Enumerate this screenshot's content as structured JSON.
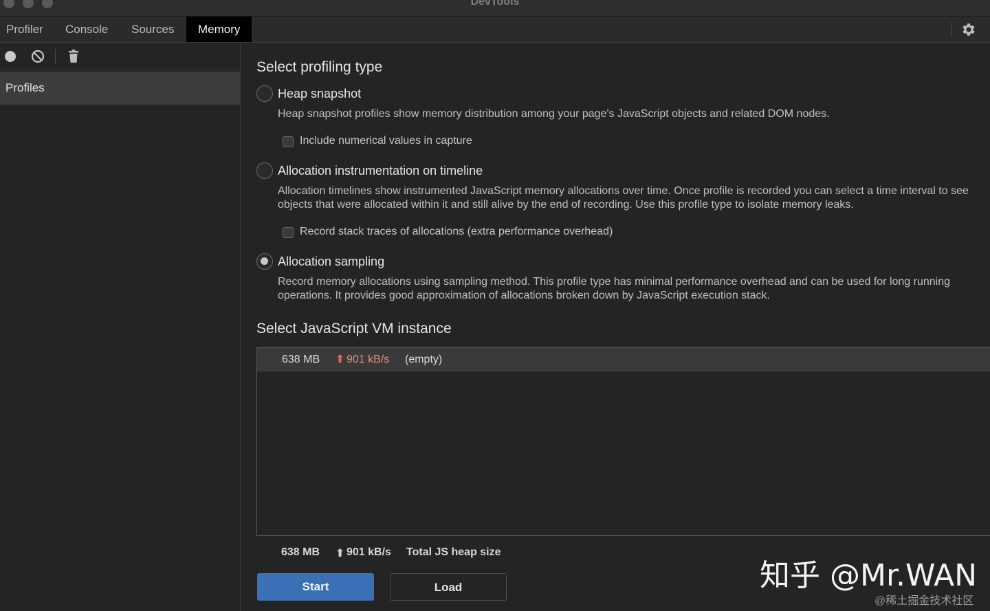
{
  "window": {
    "title": "DevTools"
  },
  "tabs": [
    {
      "label": "Profiler"
    },
    {
      "label": "Console"
    },
    {
      "label": "Sources"
    },
    {
      "label": "Memory",
      "active": true
    }
  ],
  "sidebar": {
    "toolbar": {
      "record_icon": "record-icon",
      "clear_icon": "clear-icon",
      "delete_icon": "trash-icon"
    },
    "items": [
      {
        "label": "Profiles"
      }
    ]
  },
  "profiling": {
    "title": "Select profiling type",
    "options": [
      {
        "label": "Heap snapshot",
        "description": "Heap snapshot profiles show memory distribution among your page's JavaScript objects and related DOM nodes.",
        "checkbox_label": "Include numerical values in capture",
        "selected": false
      },
      {
        "label": "Allocation instrumentation on timeline",
        "description": "Allocation timelines show instrumented JavaScript memory allocations over time. Once profile is recorded you can select a time interval to see objects that were allocated within it and still alive by the end of recording. Use this profile type to isolate memory leaks.",
        "checkbox_label": "Record stack traces of allocations (extra performance overhead)",
        "selected": false
      },
      {
        "label": "Allocation sampling",
        "description": "Record memory allocations using sampling method. This profile type has minimal performance overhead and can be used for long running operations. It provides good approximation of allocations broken down by JavaScript execution stack.",
        "selected": true
      }
    ]
  },
  "vm": {
    "title": "Select JavaScript VM instance",
    "instances": [
      {
        "size": "638 MB",
        "rate": "901 kB/s",
        "name": "(empty)"
      }
    ]
  },
  "footer": {
    "size": "638 MB",
    "rate": "901 kB/s",
    "label": "Total JS heap size",
    "start_label": "Start",
    "load_label": "Load"
  },
  "watermark": {
    "main": "知乎 @Mr.WAN",
    "sub": "@稀土掘金技术社区"
  },
  "colors": {
    "accent": "#3b6fb6",
    "rate": "#e98d7d",
    "background": "#242424"
  }
}
